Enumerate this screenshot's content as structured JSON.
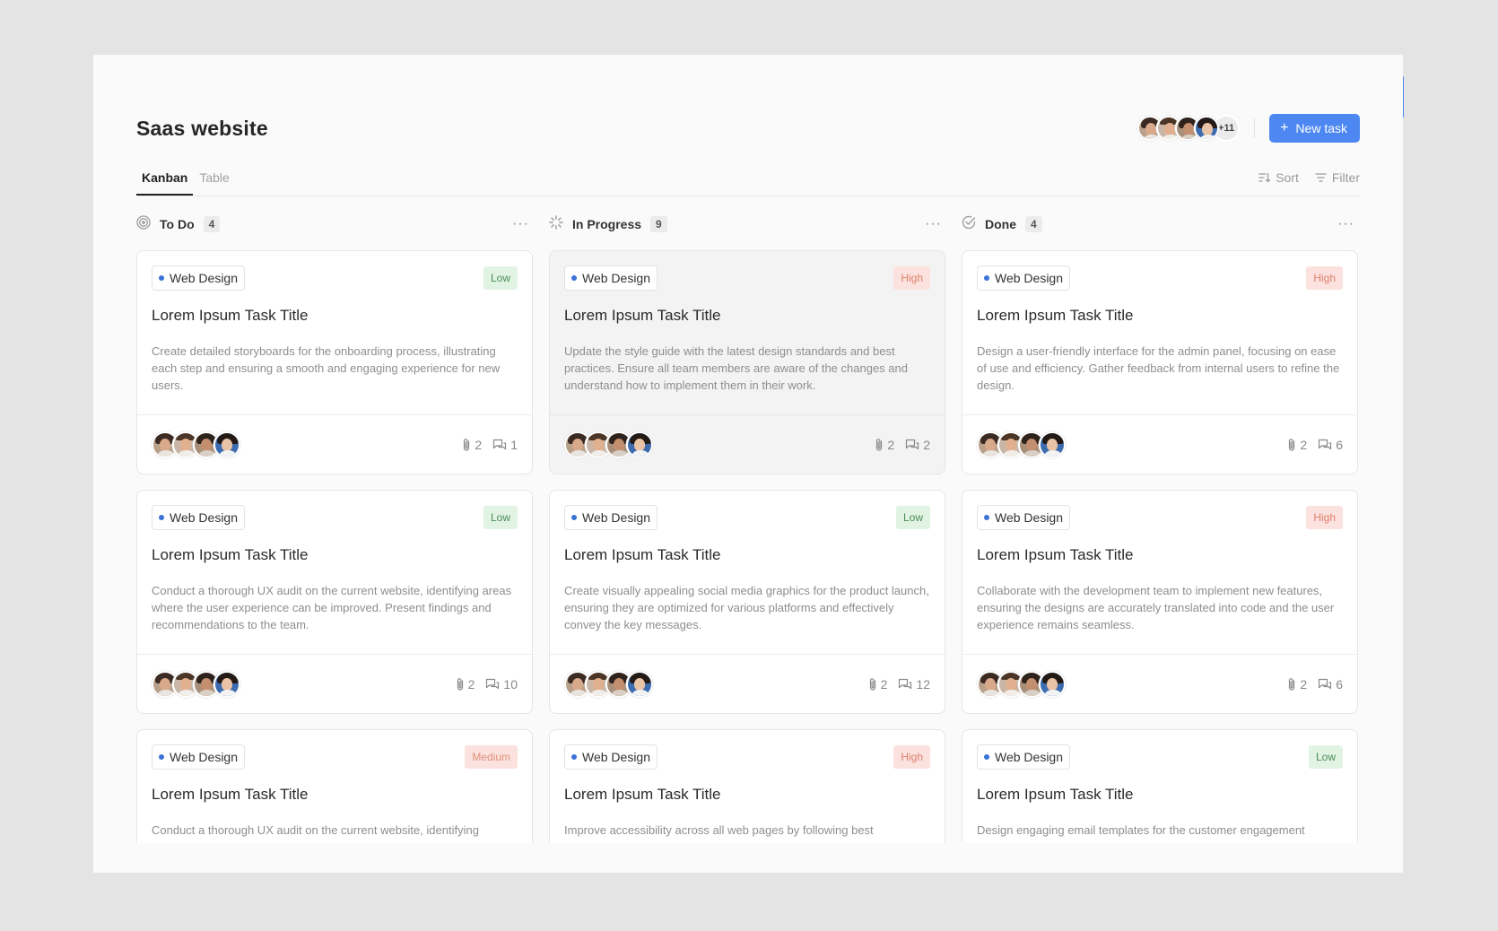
{
  "project": {
    "title": "Saas website",
    "extra_members": "+11",
    "new_task_label": "New task",
    "new_task_icon": "plus-icon"
  },
  "view_tabs": [
    {
      "label": "Kanban",
      "active": true
    },
    {
      "label": "Table",
      "active": false
    }
  ],
  "toolbar": {
    "sort_label": "Sort",
    "filter_label": "Filter"
  },
  "columns": [
    {
      "title": "To Do",
      "count": "4",
      "status_icon": "todo-status-icon",
      "cards": [
        {
          "tag": "Web Design",
          "priority": "Low",
          "title": "Lorem Ipsum Task Title",
          "desc": "Create detailed storyboards for the onboarding process, illustrating each step and ensuring a smooth and engaging experience for new users.",
          "attachments": "2",
          "comments": "1"
        },
        {
          "tag": "Web Design",
          "priority": "Low",
          "title": "Lorem Ipsum Task Title",
          "desc": "Conduct a thorough UX audit on the current website, identifying areas where the user experience can be improved. Present findings and recommendations to the team.",
          "attachments": "2",
          "comments": "10"
        },
        {
          "tag": "Web Design",
          "priority": "Medium",
          "title": "Lorem Ipsum Task Title",
          "desc": "Conduct a thorough UX audit on the current website, identifying",
          "attachments": "",
          "comments": ""
        }
      ]
    },
    {
      "title": "In Progress",
      "count": "9",
      "status_icon": "in-progress-status-icon",
      "cards": [
        {
          "tag": "Web Design",
          "priority": "High",
          "title": "Lorem Ipsum Task Title",
          "desc": "Update the style guide with the latest design standards and best practices. Ensure all team members are aware of the changes and understand how to implement them in their work.",
          "attachments": "2",
          "comments": "2"
        },
        {
          "tag": "Web Design",
          "priority": "Low",
          "title": "Lorem Ipsum Task Title",
          "desc": "Create visually appealing social media graphics for the product launch, ensuring they are optimized for various platforms and effectively convey the key messages.",
          "attachments": "2",
          "comments": "12"
        },
        {
          "tag": "Web Design",
          "priority": "High",
          "title": "Lorem Ipsum Task Title",
          "desc": "Improve accessibility across all web pages by following best",
          "attachments": "",
          "comments": ""
        }
      ]
    },
    {
      "title": "Done",
      "count": "4",
      "status_icon": "done-status-icon",
      "cards": [
        {
          "tag": "Web Design",
          "priority": "High",
          "title": "Lorem Ipsum Task Title",
          "desc": "Design a user-friendly interface for the admin panel, focusing on ease of use and efficiency. Gather feedback from internal users to refine the design.",
          "attachments": "2",
          "comments": "6"
        },
        {
          "tag": "Web Design",
          "priority": "High",
          "title": "Lorem Ipsum Task Title",
          "desc": "Collaborate with the development team to implement new features, ensuring the designs are accurately translated into code and the user experience remains seamless.",
          "attachments": "2",
          "comments": "6"
        },
        {
          "tag": "Web Design",
          "priority": "Low",
          "title": "Lorem Ipsum Task Title",
          "desc": "Design engaging email templates for the customer engagement",
          "attachments": "",
          "comments": ""
        }
      ]
    }
  ],
  "colors": {
    "accent": "#4d88f2",
    "tag_dot": "#3a72d6",
    "priority_low_bg": "#e1f3e3",
    "priority_high_bg": "#fbe2de"
  }
}
